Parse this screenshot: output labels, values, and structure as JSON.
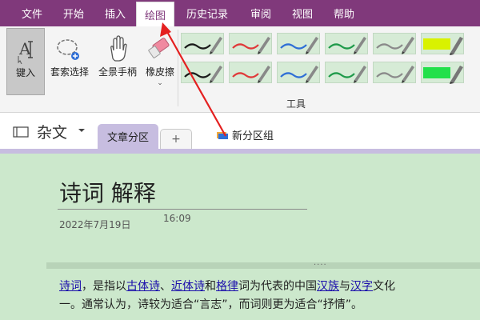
{
  "menu": {
    "items": [
      {
        "label": "文件",
        "active": false
      },
      {
        "label": "开始",
        "active": false
      },
      {
        "label": "插入",
        "active": false
      },
      {
        "label": "绘图",
        "active": true
      },
      {
        "label": "历史记录",
        "active": false
      },
      {
        "label": "审阅",
        "active": false
      },
      {
        "label": "视图",
        "active": false
      },
      {
        "label": "帮助",
        "active": false
      }
    ]
  },
  "ribbon": {
    "tools": {
      "type": "键入",
      "lasso": "套索选择",
      "pan": "全景手柄",
      "eraser": "橡皮擦"
    },
    "group_label": "工具",
    "pen_colors": [
      "#1a1a1a",
      "#e03a3a",
      "#2f6fd6",
      "#1f9a4a",
      "#8a8a8a",
      "#d9f200",
      "#1a1a1a",
      "#e03a3a",
      "#2f6fd6",
      "#1f9a4a",
      "#8a8a8a",
      "#22e04a"
    ]
  },
  "notebook": {
    "name": "杂文",
    "section_tab": "文章分区",
    "add_tab": "+",
    "section_group": "新分区组"
  },
  "page": {
    "title": "诗词 解释",
    "date": "2022年7月19日",
    "time": "16:09",
    "note_grip": "····",
    "content": {
      "line1": [
        {
          "t": "诗词",
          "link": true
        },
        {
          "t": "，是指以",
          "link": false
        },
        {
          "t": "古体诗",
          "link": true
        },
        {
          "t": "、",
          "link": false
        },
        {
          "t": "近体诗",
          "link": true
        },
        {
          "t": "和",
          "link": false
        },
        {
          "t": "格律",
          "link": true
        },
        {
          "t": "词为代表的中国",
          "link": false
        },
        {
          "t": "汉族",
          "link": true
        },
        {
          "t": "与",
          "link": false
        },
        {
          "t": "汉字",
          "link": true
        },
        {
          "t": "文化",
          "link": false
        }
      ],
      "line2": "一。通常认为，诗较为适合“言志”，而词则更为适合“抒情”。"
    }
  }
}
